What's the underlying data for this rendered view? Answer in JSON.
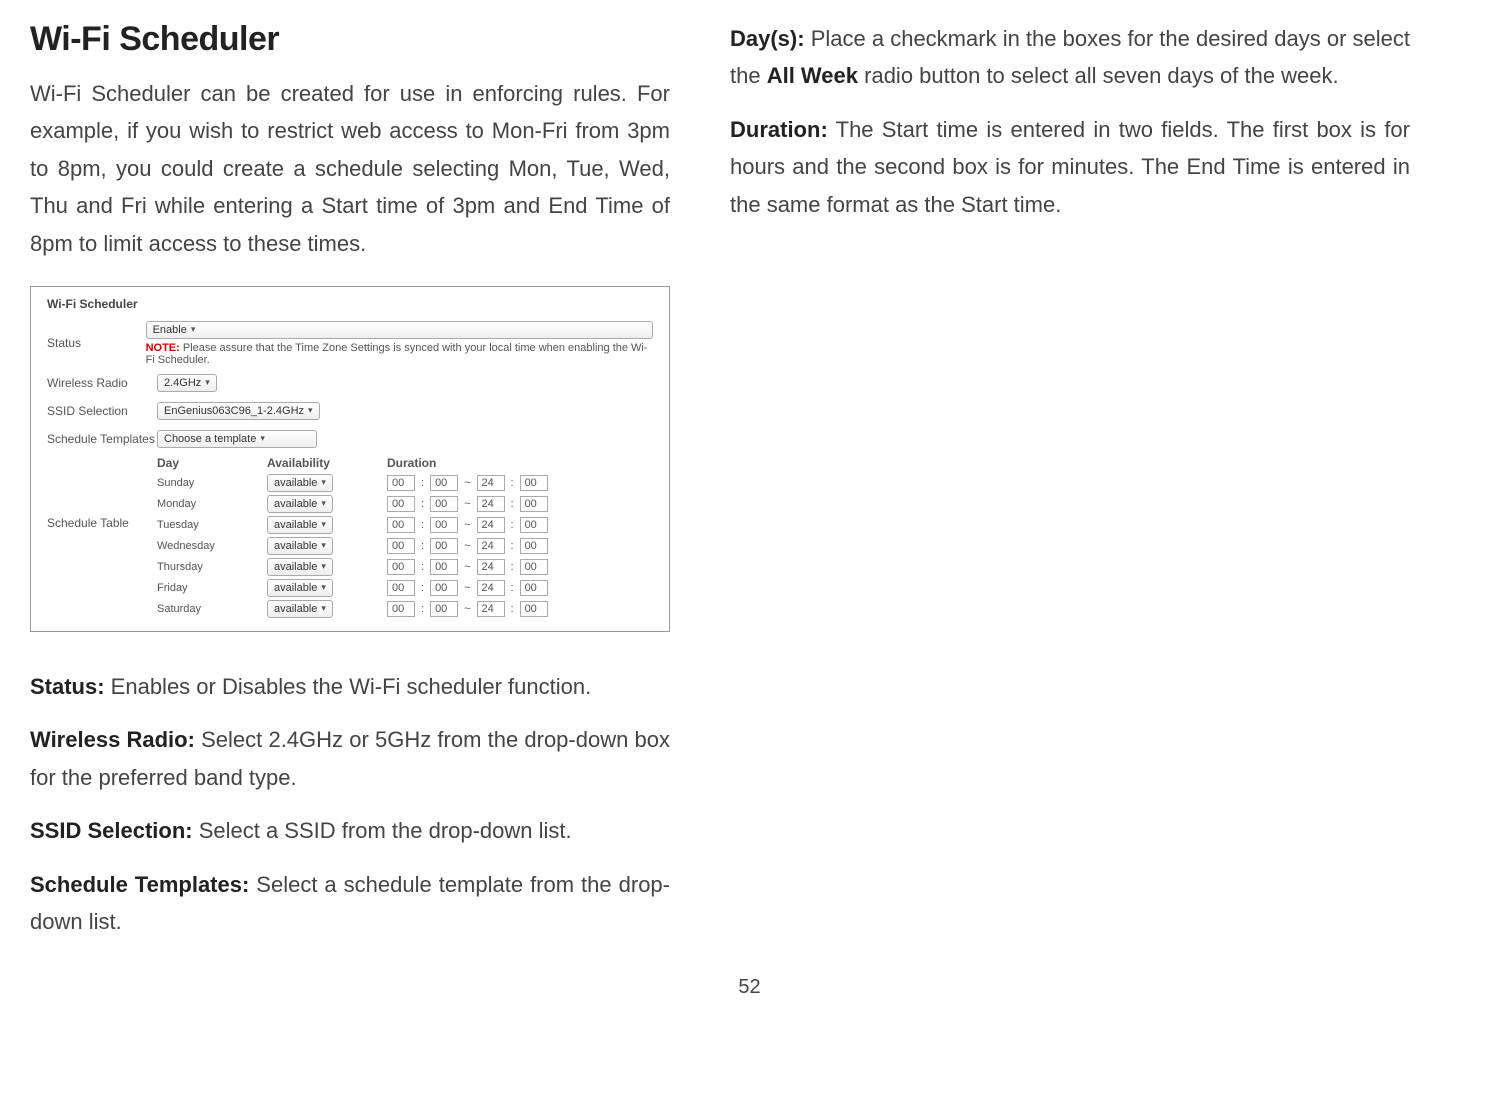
{
  "page_number": "52",
  "left": {
    "title": "Wi-Fi Scheduler",
    "intro": "Wi-Fi Scheduler can be created for use in enforcing rules. For example, if you wish to restrict web access to Mon-Fri from 3pm to 8pm, you could create a schedule selecting Mon, Tue, Wed, Thu and Fri while entering a Start time of 3pm and End Time of 8pm to limit access to these times.",
    "status_label": "Status:",
    "status_text": " Enables or Disables the Wi-Fi scheduler function.",
    "wireless_label": "Wireless Radio:",
    "wireless_text": " Select 2.4GHz or 5GHz from the drop-down box for the preferred band type.",
    "ssid_label": "SSID Selection:",
    "ssid_text": " Select a SSID from the drop-down list.",
    "templates_label": "Schedule Templates:",
    "templates_text": " Select a schedule template from the drop-down list."
  },
  "right": {
    "days_label": "Day(s):",
    "days_text_1": " Place a checkmark in the boxes for the desired days or select the ",
    "days_bold_2": "All Week",
    "days_text_2": " radio button to select all seven days of the week.",
    "duration_label": "Duration:",
    "duration_text": " The Start time is entered in two fields. The first box is for hours and the second box is for minutes. The End Time is entered in the same format as the Start time."
  },
  "screenshot": {
    "section_title": "Wi-Fi Scheduler",
    "status_label": "Status",
    "status_select": "Enable",
    "note_label": "NOTE:",
    "note_text": "  Please assure that the Time Zone Settings is synced with your local time when enabling the Wi-Fi Scheduler.",
    "radio_label": "Wireless Radio",
    "radio_select": "2.4GHz",
    "ssid_label": "SSID Selection",
    "ssid_select": "EnGenius063C96_1-2.4GHz",
    "templates_label": "Schedule Templates",
    "templates_select": "Choose a template",
    "schedule_table_label": "Schedule Table",
    "thead": {
      "day": "Day",
      "avail": "Availability",
      "duration": "Duration"
    },
    "rows": [
      {
        "day": "Sunday",
        "avail": "available",
        "sh": "00",
        "sm": "00",
        "eh": "24",
        "em": "00"
      },
      {
        "day": "Monday",
        "avail": "available",
        "sh": "00",
        "sm": "00",
        "eh": "24",
        "em": "00"
      },
      {
        "day": "Tuesday",
        "avail": "available",
        "sh": "00",
        "sm": "00",
        "eh": "24",
        "em": "00"
      },
      {
        "day": "Wednesday",
        "avail": "available",
        "sh": "00",
        "sm": "00",
        "eh": "24",
        "em": "00"
      },
      {
        "day": "Thursday",
        "avail": "available",
        "sh": "00",
        "sm": "00",
        "eh": "24",
        "em": "00"
      },
      {
        "day": "Friday",
        "avail": "available",
        "sh": "00",
        "sm": "00",
        "eh": "24",
        "em": "00"
      },
      {
        "day": "Saturday",
        "avail": "available",
        "sh": "00",
        "sm": "00",
        "eh": "24",
        "em": "00"
      }
    ]
  }
}
